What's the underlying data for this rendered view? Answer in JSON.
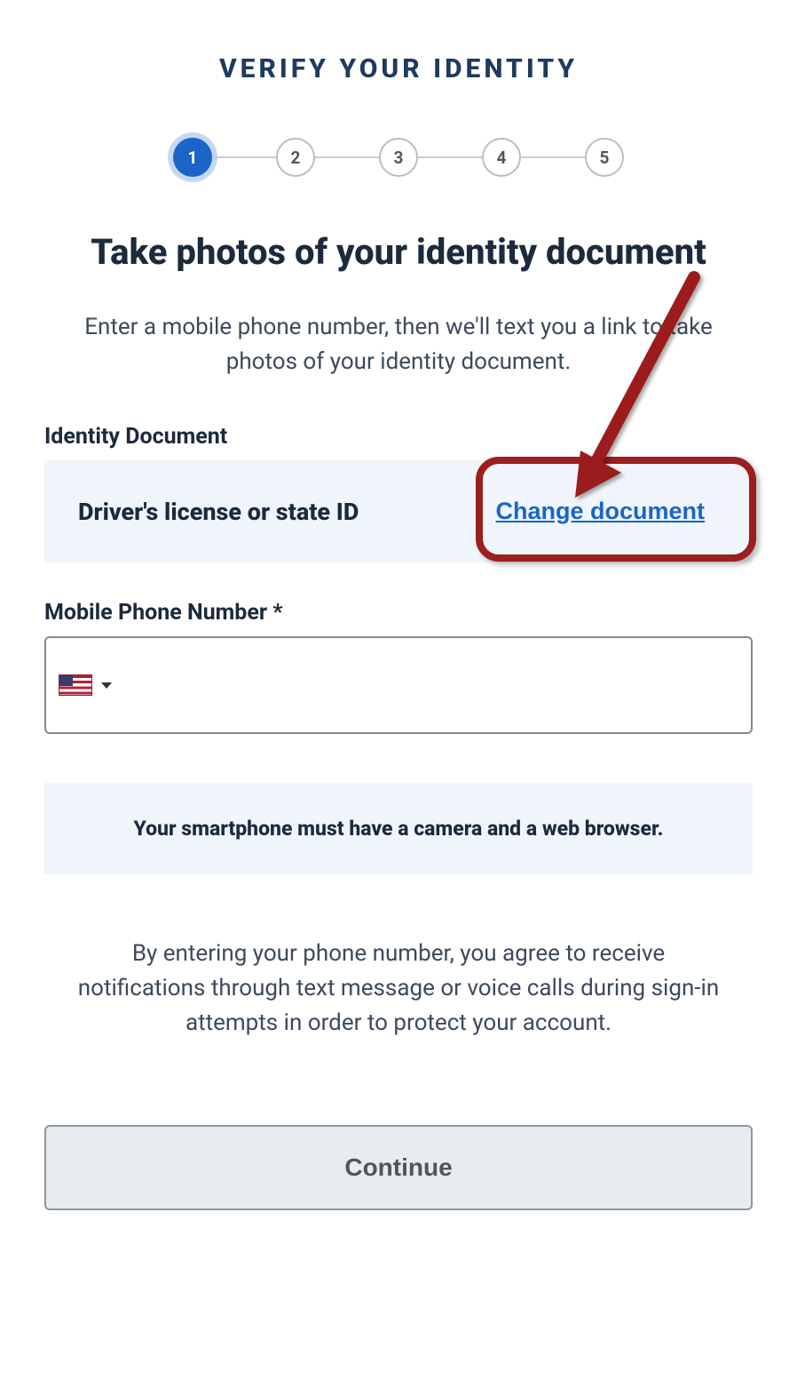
{
  "header": {
    "title": "VERIFY YOUR IDENTITY"
  },
  "stepper": {
    "steps": [
      "1",
      "2",
      "3",
      "4",
      "5"
    ],
    "active_index": 0
  },
  "main": {
    "subheading": "Take photos of your identity document",
    "description": "Enter a mobile phone number, then we'll text you a link to take photos of your identity document.",
    "identity_section": {
      "label": "Identity Document",
      "value": "Driver's license or state ID",
      "change_link": "Change document"
    },
    "phone_section": {
      "label": "Mobile Phone Number *",
      "country_code_icon": "us-flag",
      "value": ""
    },
    "info_box": "Your smartphone must have a camera and a web browser.",
    "consent_text": "By entering your phone number, you agree to receive notifications through text message or voice calls during sign-in attempts in order to protect your account.",
    "continue_label": "Continue"
  },
  "annotation": {
    "arrow_color": "#9b1f1f"
  }
}
